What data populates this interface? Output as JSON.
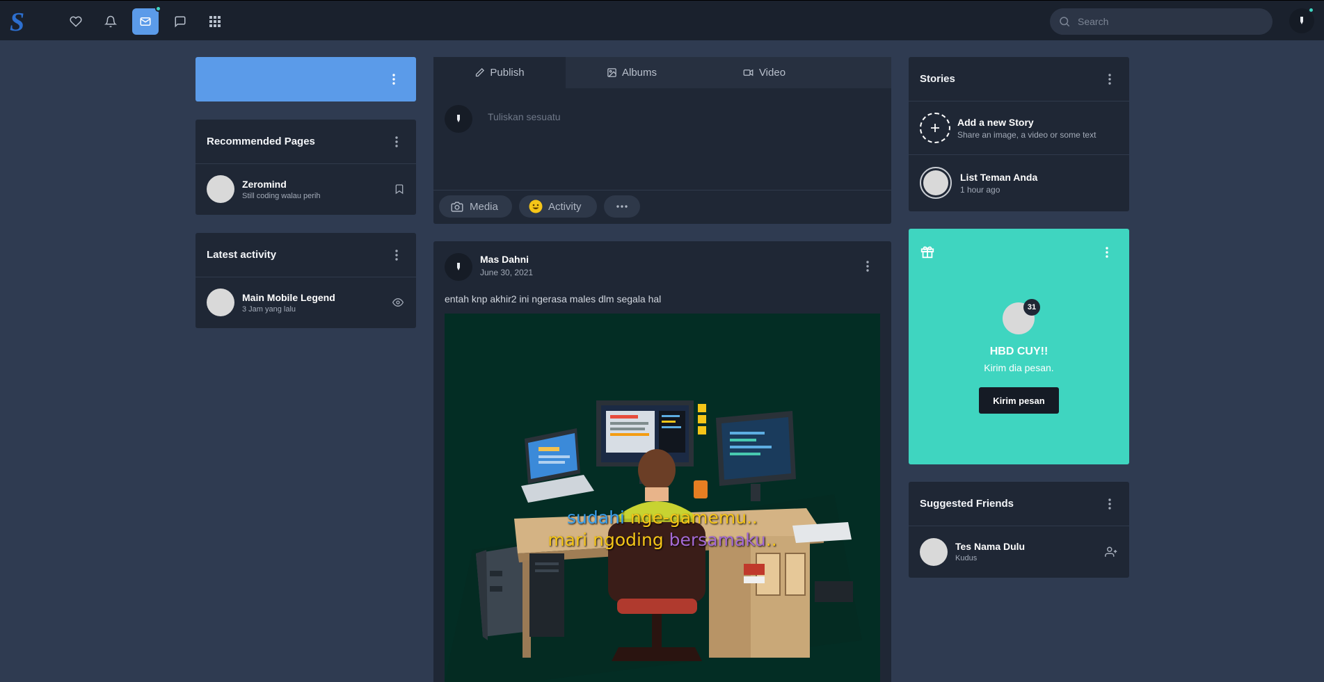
{
  "navbar": {
    "logo_letter": "S",
    "search_placeholder": "Search",
    "icons": [
      "heart-icon",
      "bell-icon",
      "mail-icon",
      "chat-icon",
      "apps-grid-icon"
    ],
    "accent": "#5b9be9",
    "notify_color": "#3fd5c0"
  },
  "recommended": {
    "title": "Recommended Pages",
    "item": {
      "name": "Zeromind",
      "sub": "Still coding walau perih"
    }
  },
  "latest": {
    "title": "Latest activity",
    "item": {
      "name": "Main Mobile Legend",
      "sub": "3 Jam yang lalu"
    }
  },
  "composer": {
    "tabs": [
      "Publish",
      "Albums",
      "Video"
    ],
    "placeholder": "Tuliskan sesuatu",
    "media": "Media",
    "activity": "Activity"
  },
  "post": {
    "author": "Mas Dahni",
    "date": "June 30, 2021",
    "text": "entah knp akhir2 ini ngerasa males dlm segala hal",
    "image_line1_a": "sudahi",
    "image_line1_b": "nge-gamemu..",
    "image_line2_a": "mari ngoding",
    "image_line2_b": "bersamaku",
    "image_line2_c": ".."
  },
  "stories": {
    "title": "Stories",
    "add_title": "Add a new Story",
    "add_sub": "Share an image, a video or some text",
    "friend_title": "List Teman Anda",
    "friend_sub": "1 hour ago"
  },
  "birthday": {
    "badge": "31",
    "title": "HBD CUY!!",
    "sub": "Kirim dia pesan.",
    "button": "Kirim pesan",
    "bg": "#3fd5c0"
  },
  "suggested": {
    "title": "Suggested Friends",
    "item": {
      "name": "Tes Nama Dulu",
      "sub": "Kudus"
    }
  }
}
